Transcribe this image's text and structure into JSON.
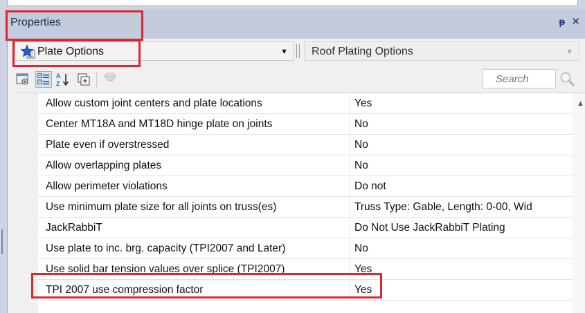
{
  "panel": {
    "title": "Properties",
    "pin_glyph": "ᵽ",
    "close_glyph": "✕"
  },
  "selector": {
    "left_value": "Plate Options",
    "right_value": "Roof Plating Options",
    "star_icon": "star-document-icon"
  },
  "toolbar": {
    "buttons": [
      "property-pages-icon",
      "categorized-view-icon",
      "alphabetical-sort-icon",
      "expand-all-icon",
      "filter-icon"
    ],
    "search_placeholder": "Search"
  },
  "grid": {
    "rows": [
      {
        "name": "Allow custom joint centers and plate locations",
        "value": "Yes"
      },
      {
        "name": "Center MT18A and MT18D hinge plate on joints",
        "value": "No"
      },
      {
        "name": "Plate even if overstressed",
        "value": "No"
      },
      {
        "name": "Allow overlapping plates",
        "value": "No"
      },
      {
        "name": "Allow perimeter violations",
        "value": "Do not"
      },
      {
        "name": "Use minimum plate size for all joints on truss(es)",
        "value": "Truss Type: Gable, Length: 0-00, Wid"
      },
      {
        "name": "JackRabbiT",
        "value": "Do Not Use JackRabbiT Plating"
      },
      {
        "name": "Use plate to inc. brg. capacity (TPI2007 and Later)",
        "value": "No"
      },
      {
        "name": "Use solid bar tension values over splice (TPI2007)",
        "value": "Yes"
      },
      {
        "name": "TPI 2007 use compression factor",
        "value": "Yes"
      }
    ]
  },
  "colors": {
    "highlight": "#e0252f",
    "titlebar": "#c3cbdc",
    "star": "#1f62c8"
  }
}
